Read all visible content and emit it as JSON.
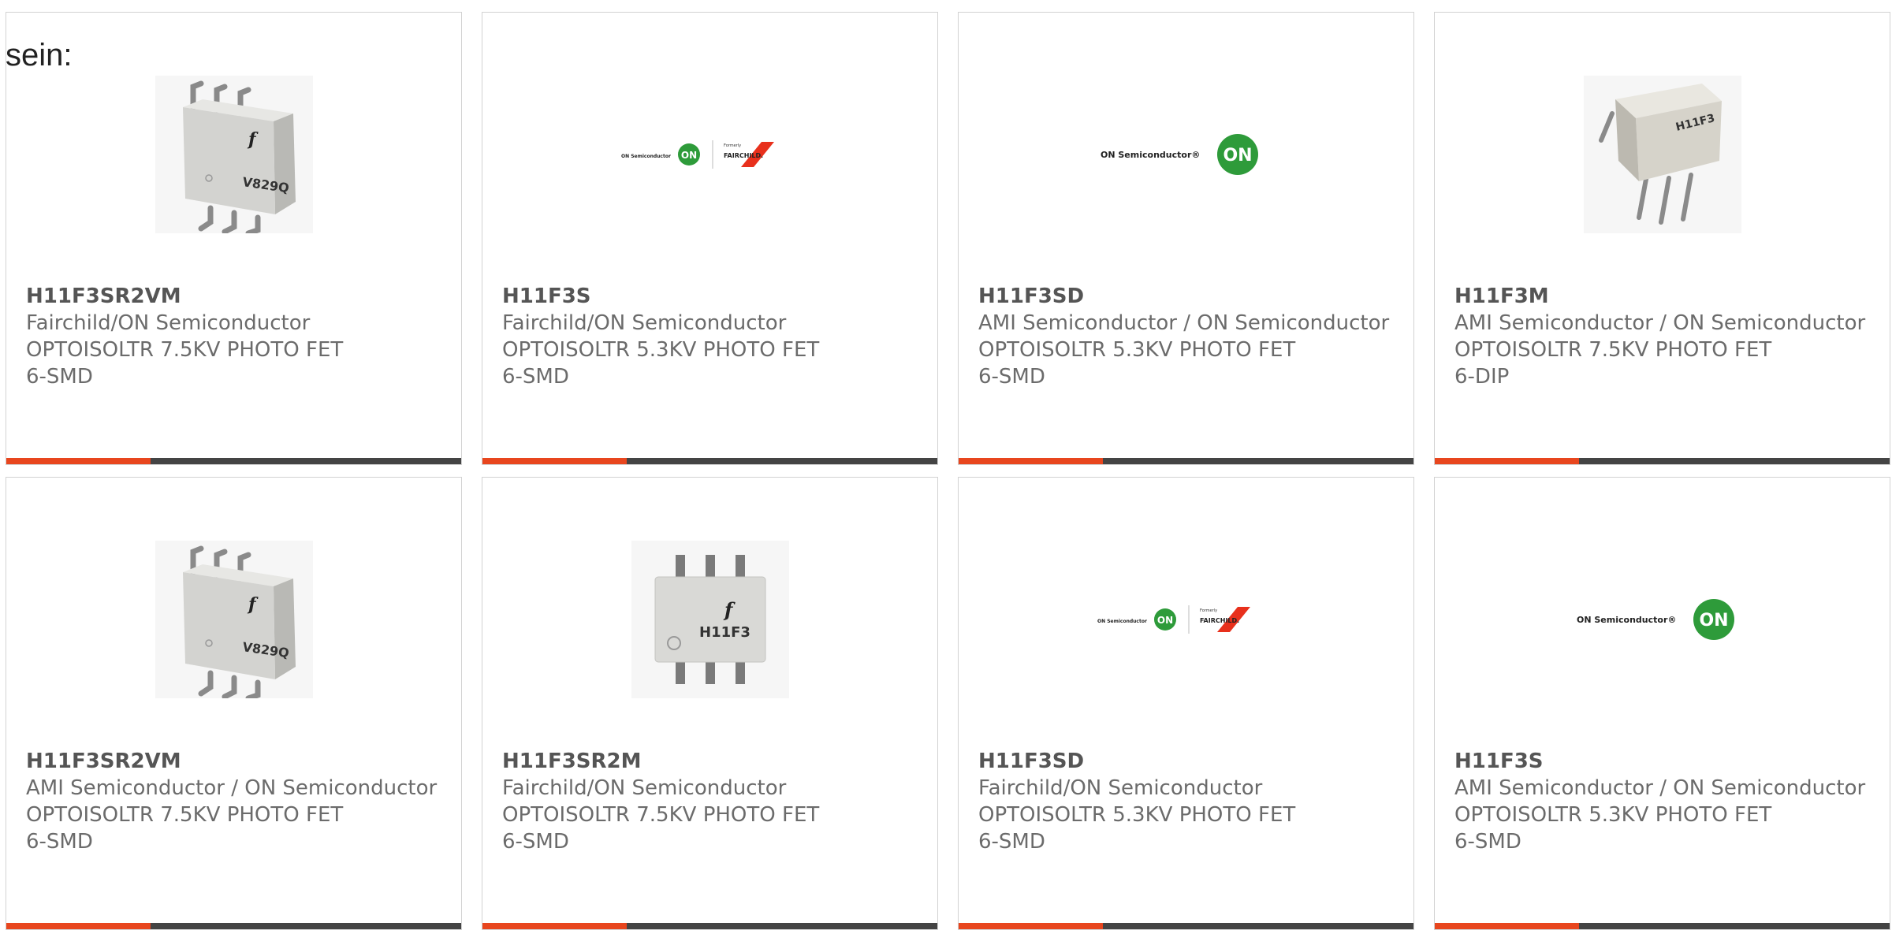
{
  "lead_text": "sein:",
  "colors": {
    "accent": "#e8461e",
    "bar": "#444444",
    "border": "#d2d2d2",
    "on_green": "#2e9b3a",
    "fairchild_red": "#e8301c"
  },
  "cards": [
    {
      "part": "H11F3SR2VM",
      "manufacturer": "Fairchild/ON Semiconductor",
      "description": "OPTOISOLTR 7.5KV PHOTO FET",
      "package": "6-SMD",
      "image": "smd-optocoupler-photo",
      "chip_marking": "V829Q"
    },
    {
      "part": "H11F3S",
      "manufacturer": "Fairchild/ON Semiconductor",
      "description": "OPTOISOLTR 5.3KV PHOTO FET",
      "package": "6-SMD",
      "image": "on-fairchild-logo",
      "logo_brand": "ON Semiconductor",
      "logo_formerly": "Formerly",
      "logo_fairchild": "FAIRCHILD."
    },
    {
      "part": "H11F3SD",
      "manufacturer": "AMI Semiconductor / ON Semiconductor",
      "description": "OPTOISOLTR 5.3KV PHOTO FET",
      "package": "6-SMD",
      "image": "on-semiconductor-logo",
      "logo_brand": "ON Semiconductor"
    },
    {
      "part": "H11F3M",
      "manufacturer": "AMI Semiconductor / ON Semiconductor",
      "description": "OPTOISOLTR 7.5KV PHOTO FET",
      "package": "6-DIP",
      "image": "dip-optocoupler-photo",
      "chip_marking": "H11F3"
    },
    {
      "part": "H11F3SR2VM",
      "manufacturer": "AMI Semiconductor / ON Semiconductor",
      "description": "OPTOISOLTR 7.5KV PHOTO FET",
      "package": "6-SMD",
      "image": "smd-optocoupler-photo",
      "chip_marking": "V829Q"
    },
    {
      "part": "H11F3SR2M",
      "manufacturer": "Fairchild/ON Semiconductor",
      "description": "OPTOISOLTR 7.5KV PHOTO FET",
      "package": "6-SMD",
      "image": "smd-topview-photo",
      "chip_marking": "H11F3"
    },
    {
      "part": "H11F3SD",
      "manufacturer": "Fairchild/ON Semiconductor",
      "description": "OPTOISOLTR 5.3KV PHOTO FET",
      "package": "6-SMD",
      "image": "on-fairchild-logo",
      "logo_brand": "ON Semiconductor",
      "logo_formerly": "Formerly",
      "logo_fairchild": "FAIRCHILD."
    },
    {
      "part": "H11F3S",
      "manufacturer": "AMI Semiconductor / ON Semiconductor",
      "description": "OPTOISOLTR 5.3KV PHOTO FET",
      "package": "6-SMD",
      "image": "on-semiconductor-logo",
      "logo_brand": "ON Semiconductor"
    }
  ]
}
